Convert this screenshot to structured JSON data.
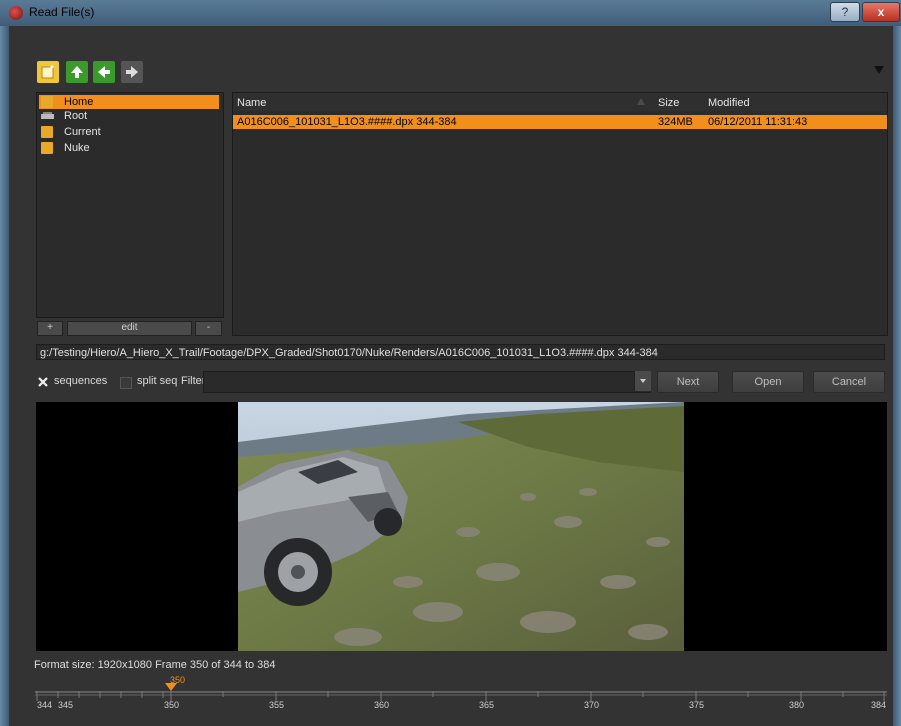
{
  "window": {
    "title": "Read File(s)",
    "help_label": "?",
    "close_label": "x"
  },
  "toolbar": {
    "icons": [
      "new-folder-icon",
      "up-arrow-icon",
      "back-arrow-icon",
      "forward-arrow-icon"
    ]
  },
  "bookmarks": {
    "items": [
      {
        "label": "Home",
        "icon": "folder-icon",
        "selected": true
      },
      {
        "label": "Root",
        "icon": "drive-icon",
        "selected": false
      },
      {
        "label": "Current",
        "icon": "folder-icon",
        "selected": false
      },
      {
        "label": "Nuke",
        "icon": "folder-icon",
        "selected": false
      }
    ],
    "add_label": "+",
    "edit_label": "edit",
    "remove_label": "-"
  },
  "files": {
    "columns": {
      "name": "Name",
      "size": "Size",
      "modified": "Modified"
    },
    "rows": [
      {
        "name": "A016C006_101031_L1O3.####.dpx 344-384",
        "size": "324MB",
        "modified": "06/12/2011 11:31:43",
        "selected": true
      }
    ]
  },
  "path": "g:/Testing/Hiero/A_Hiero_X_Trail/Footage/DPX_Graded/Shot0170/Nuke/Renders/A016C006_101031_L1O3.####.dpx 344-384",
  "options": {
    "sequences_label": "sequences",
    "sequences_checked": true,
    "split_seq_label": "split seq",
    "split_seq_checked": false,
    "filter_label": "Filter:",
    "filter_value": ""
  },
  "buttons": {
    "next": "Next",
    "open": "Open",
    "cancel": "Cancel"
  },
  "format_info": "Format size: 1920x1080   Frame 350 of 344 to 384",
  "timeline": {
    "current_frame": "350",
    "labels": [
      "344",
      "345",
      "350",
      "355",
      "360",
      "365",
      "370",
      "375",
      "380",
      "384"
    ]
  },
  "colors": {
    "accent": "#f28e1c",
    "panel": "#333333",
    "list_bg": "#2b2b2b"
  }
}
